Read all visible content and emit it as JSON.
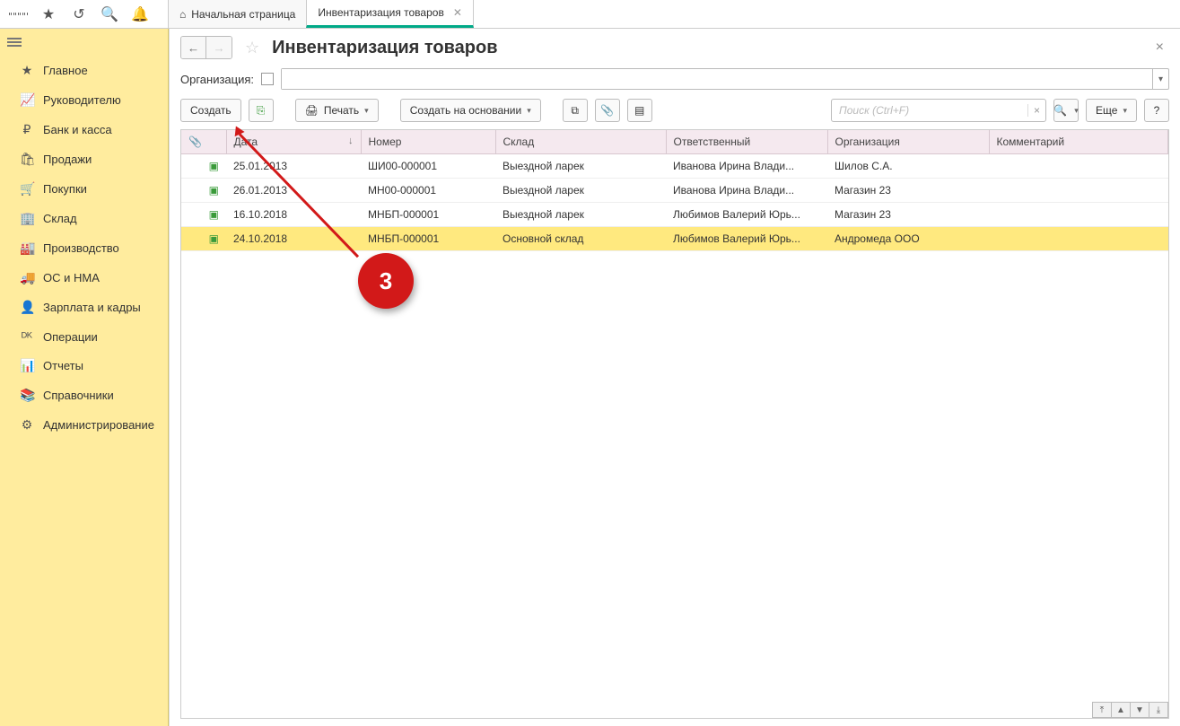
{
  "topbar": {
    "tabs": [
      {
        "label": "Начальная страница"
      },
      {
        "label": "Инвентаризация товаров"
      }
    ]
  },
  "sidebar": {
    "items": [
      {
        "icon": "★",
        "label": "Главное"
      },
      {
        "icon": "📈",
        "label": "Руководителю"
      },
      {
        "icon": "₽",
        "label": "Банк и касса"
      },
      {
        "icon": "🛍",
        "label": "Продажи"
      },
      {
        "icon": "🛒",
        "label": "Покупки"
      },
      {
        "icon": "🏢",
        "label": "Склад"
      },
      {
        "icon": "🏭",
        "label": "Производство"
      },
      {
        "icon": "🚚",
        "label": "ОС и НМА"
      },
      {
        "icon": "👤",
        "label": "Зарплата и кадры"
      },
      {
        "icon": "ᴰᴷ",
        "label": "Операции"
      },
      {
        "icon": "📊",
        "label": "Отчеты"
      },
      {
        "icon": "📚",
        "label": "Справочники"
      },
      {
        "icon": "⚙",
        "label": "Администрирование"
      }
    ]
  },
  "page": {
    "title": "Инвентаризация товаров",
    "org_label": "Организация:"
  },
  "toolbar": {
    "create": "Создать",
    "print": "Печать",
    "create_based": "Создать на основании",
    "more": "Еще",
    "search_placeholder": "Поиск (Ctrl+F)"
  },
  "table": {
    "columns": [
      "",
      "Дата",
      "Номер",
      "Склад",
      "Ответственный",
      "Организация",
      "Комментарий"
    ],
    "rows": [
      {
        "date": "25.01.2013",
        "num": "ШИ00-000001",
        "wh": "Выездной ларек",
        "resp": "Иванова Ирина Влади...",
        "org": "Шилов С.А.",
        "comment": ""
      },
      {
        "date": "26.01.2013",
        "num": "МН00-000001",
        "wh": "Выездной ларек",
        "resp": "Иванова Ирина Влади...",
        "org": "Магазин 23",
        "comment": ""
      },
      {
        "date": "16.10.2018",
        "num": "МНБП-000001",
        "wh": "Выездной ларек",
        "resp": "Любимов Валерий Юрь...",
        "org": "Магазин 23",
        "comment": ""
      },
      {
        "date": "24.10.2018",
        "num": "МНБП-000001",
        "wh": "Основной склад",
        "resp": "Любимов Валерий Юрь...",
        "org": "Андромеда ООО",
        "comment": ""
      }
    ],
    "selected": 3
  },
  "annotation": {
    "label": "3"
  }
}
